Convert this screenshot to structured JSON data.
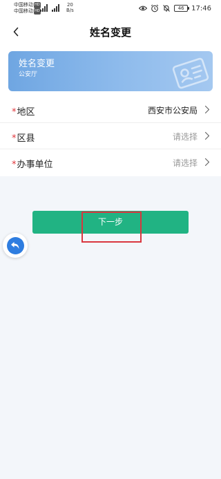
{
  "status_bar": {
    "carrier1": "中国移动",
    "carrier2": "中国移动",
    "hd_badge": "HD",
    "speed_value": "20",
    "speed_unit": "B/s",
    "battery": "46",
    "time": "17:46",
    "icons": [
      "signal-icon",
      "eye-icon",
      "alarm-icon",
      "mute-icon",
      "battery-icon"
    ]
  },
  "nav": {
    "title": "姓名变更",
    "back_icon": "chevron-left-icon"
  },
  "banner": {
    "title": "姓名变更",
    "subtitle": "公安厅",
    "icon": "id-card-icon"
  },
  "form": {
    "required_mark": "*",
    "rows": [
      {
        "label": "地区",
        "value": "西安市公安局"
      },
      {
        "label": "区县",
        "placeholder": "请选择"
      },
      {
        "label": "办事单位",
        "placeholder": "请选择"
      }
    ]
  },
  "next_button": {
    "label": "下一步"
  },
  "floating_button": {
    "icon": "return-arrow-icon"
  },
  "colors": {
    "primary_green": "#21b383",
    "required_red": "#e0353b",
    "banner_blue": "#6fa6e2",
    "float_blue": "#2e7de0",
    "annotation_red": "#d9363e",
    "page_bg": "#f3f6fa"
  }
}
